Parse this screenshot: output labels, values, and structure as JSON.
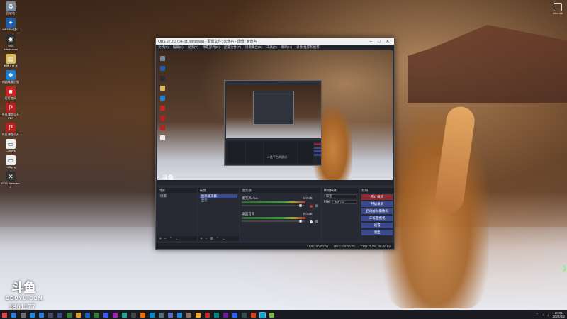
{
  "desktop": {
    "icons": [
      {
        "name": "recycle-bin-icon",
        "label": "回收站",
        "color": "#7a8a99"
      },
      {
        "name": "app-icon",
        "label": "MRDBM战斗",
        "color": "#1f5ea8"
      },
      {
        "name": "app-icon",
        "label": "MSI Afterburner",
        "color": "#2b2b2b"
      },
      {
        "name": "file-icon",
        "label": "新建文件夹",
        "color": "#d9b95c"
      },
      {
        "name": "app-icon",
        "label": "戏剧场景识别",
        "color": "#1b7fd1"
      },
      {
        "name": "app-icon",
        "label": "叮叮房间",
        "color": "#c22"
      },
      {
        "name": "pdf-icon",
        "label": "社区课程公开 PDF",
        "color": "#b81f1f"
      },
      {
        "name": "pdf-icon",
        "label": "社区课程公开",
        "color": "#b81f1f"
      },
      {
        "name": "image-icon",
        "label": "1.28.png",
        "color": "#eeeeee"
      },
      {
        "name": "image-icon",
        "label": "1.28.png",
        "color": "#eeeeee"
      },
      {
        "name": "app-icon",
        "label": "EOS Webcam 2",
        "color": "#333333"
      }
    ],
    "right_icon_label": "intro.lnk",
    "douyu_mark": "斗鱼",
    "douyu_brand": "DOUYU.COM",
    "room_id": "1861177"
  },
  "obs": {
    "title": "OBS 27.2.3 (64-bit, windows) - 配置文件: 未命名 - 场景: 未命名",
    "menu": [
      "文件(F)",
      "编辑(E)",
      "视图(V)",
      "停靠部件(D)",
      "配置文件(P)",
      "场景集合(S)",
      "工具(T)",
      "帮助(H)",
      "录像 推荐和推荐"
    ],
    "preview_logo": "斗鱼",
    "nested_caption": "斗鱼平台的测试",
    "docks": {
      "scenes": {
        "header": "场景",
        "items": [
          "场景"
        ]
      },
      "sources": {
        "header": "来源",
        "items": [
          "显示器采集",
          "显示"
        ]
      },
      "mixer": {
        "header": "混音器",
        "tracks": [
          {
            "name": "麦克风/Aux",
            "db": "0.0 dB"
          },
          {
            "name": "桌面音频",
            "db": "0.0 dB"
          }
        ]
      },
      "transitions": {
        "header": "转场特效",
        "type": "渐变",
        "duration_label": "时长",
        "duration_value": "300 ms"
      },
      "controls": {
        "header": "控制",
        "buttons": [
          "停止推流",
          "开始录制",
          "启动虚拟摄像机",
          "工作室模式",
          "设置",
          "退出"
        ]
      }
    },
    "status": {
      "live": "LIVE: 00:00:00",
      "rec": "REC: 00:00:00",
      "cpu": "CPU: 3.2%, 30.00 fps"
    }
  },
  "taskbar": {
    "icon_colors": [
      "#e04848",
      "#2a7ad6",
      "#6d6d6d",
      "#1e88e5",
      "#2a7ad6",
      "#444c6a",
      "#3b4a8f",
      "#2e7d32",
      "#e0a030",
      "#1565c0",
      "#2e7d32",
      "#3d5afe",
      "#9c27b0",
      "#26a69a",
      "#424242",
      "#ef6c00",
      "#0288d1",
      "#546e7a",
      "#5c6bc0",
      "#1e88e5",
      "#8d6e63",
      "#f9a825",
      "#c62828",
      "#00897b",
      "#6a1b9a",
      "#2962ff",
      "#37474f",
      "#d84315",
      "#00acc1",
      "#7cb342"
    ],
    "time": "20:01",
    "date": "2022/4/2"
  }
}
